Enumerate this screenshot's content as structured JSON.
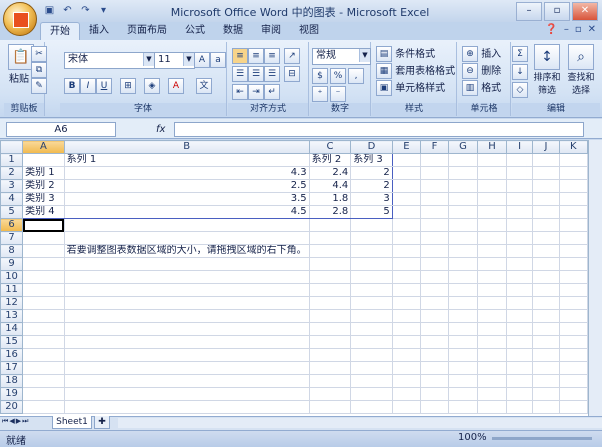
{
  "window": {
    "title": "Microsoft Office Word 中的图表 - Microsoft Excel",
    "qat": [
      "save-icon",
      "undo-icon",
      "redo-icon",
      "dropdown-icon"
    ]
  },
  "tabs": [
    {
      "label": "开始",
      "active": true
    },
    {
      "label": "插入"
    },
    {
      "label": "页面布局"
    },
    {
      "label": "公式"
    },
    {
      "label": "数据"
    },
    {
      "label": "审阅"
    },
    {
      "label": "视图"
    }
  ],
  "ribbon": {
    "clipboard": {
      "label": "剪贴板",
      "paste": "粘贴"
    },
    "font": {
      "label": "字体",
      "name": "宋体",
      "size": "11",
      "bold": "B",
      "italic": "I",
      "underline": "U"
    },
    "alignment": {
      "label": "对齐方式"
    },
    "number": {
      "label": "数字",
      "format": "常规",
      "percent": "%"
    },
    "styles": {
      "label": "样式",
      "conditional": "条件格式",
      "table": "套用表格格式",
      "cell": "单元格样式"
    },
    "cells": {
      "label": "单元格",
      "insert": "插入",
      "delete": "删除",
      "format": "格式"
    },
    "editing": {
      "label": "编辑",
      "sort": "排序和筛选",
      "find": "查找和选择"
    }
  },
  "formula_bar": {
    "name_box": "A6",
    "fx": "fx",
    "value": ""
  },
  "grid": {
    "columns": [
      "A",
      "B",
      "C",
      "D",
      "E",
      "F",
      "G",
      "H",
      "I",
      "J",
      "K"
    ],
    "rows": [
      [
        "",
        "系列 1",
        "系列 2",
        "系列 3",
        "",
        "",
        "",
        "",
        "",
        "",
        ""
      ],
      [
        "类别 1",
        "4.3",
        "2.4",
        "2",
        "",
        "",
        "",
        "",
        "",
        "",
        ""
      ],
      [
        "类别 2",
        "2.5",
        "4.4",
        "2",
        "",
        "",
        "",
        "",
        "",
        "",
        ""
      ],
      [
        "类别 3",
        "3.5",
        "1.8",
        "3",
        "",
        "",
        "",
        "",
        "",
        "",
        ""
      ],
      [
        "类别 4",
        "4.5",
        "2.8",
        "5",
        "",
        "",
        "",
        "",
        "",
        "",
        ""
      ],
      [
        "",
        "",
        "",
        "",
        "",
        "",
        "",
        "",
        "",
        "",
        ""
      ],
      [
        "",
        "",
        "",
        "",
        "",
        "",
        "",
        "",
        "",
        "",
        ""
      ],
      [
        "",
        "若要调整图表数据区域的大小，请拖拽区域的右下角。",
        "",
        "",
        "",
        "",
        "",
        "",
        "",
        "",
        ""
      ]
    ],
    "row_count": 20,
    "active_cell": "A6"
  },
  "sheet_tabs": [
    {
      "label": "Sheet1"
    }
  ],
  "status": {
    "text": "就绪",
    "zoom": "100%"
  }
}
